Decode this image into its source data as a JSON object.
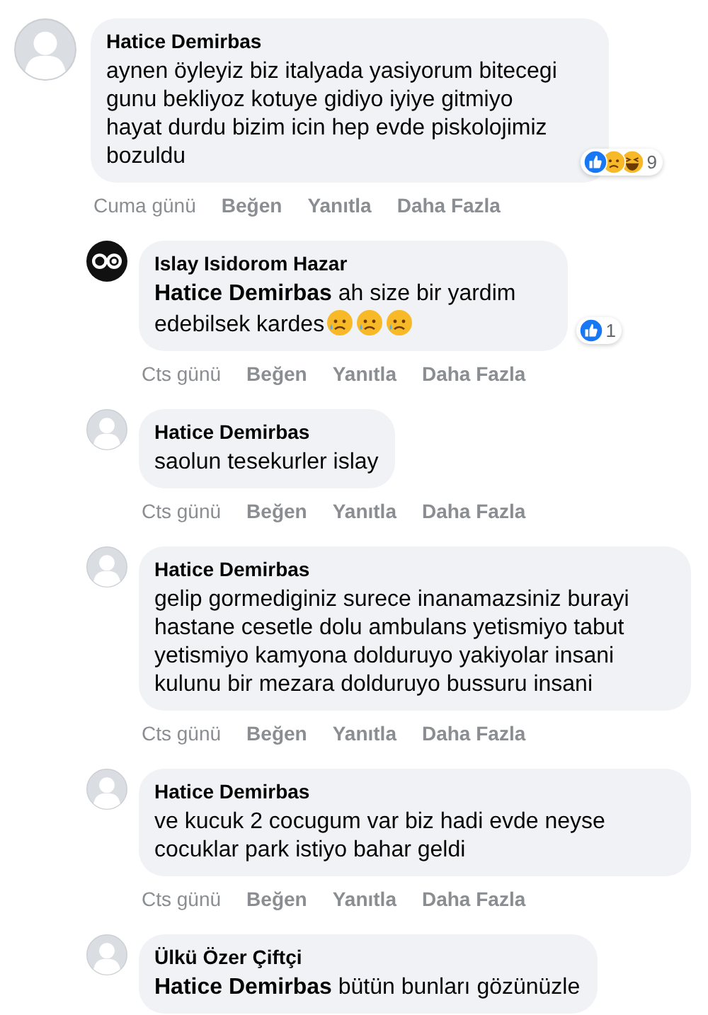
{
  "comments": [
    {
      "kind": "top",
      "avatar": {
        "kind": "default"
      },
      "author": "Hatice Demirbas",
      "text": "aynen öyleyiz biz italyada yasiyorum bitecegi gunu bekliyoz kotuye gidiyo iyiye gitmiyo hayat durdu bizim icin hep evde piskolojimiz bozuldu",
      "reactions": [
        {
          "kind": "like"
        },
        {
          "kind": "sad"
        },
        {
          "kind": "haha"
        }
      ],
      "reaction_count": "9",
      "time": "Cuma günü",
      "actions": [
        "Beğen",
        "Yanıtla",
        "Daha Fazla"
      ]
    },
    {
      "kind": "reply",
      "avatar": {
        "kind": "custom"
      },
      "author": "Islay Isidorom Hazar",
      "text": "**Hatice Demirbas** ah size bir yardim edebilsek kardes",
      "emojis": [
        {
          "kind": "sad"
        },
        {
          "kind": "sad"
        },
        {
          "kind": "sad"
        }
      ],
      "reactions": [
        {
          "kind": "like"
        }
      ],
      "reaction_count": "1",
      "time": "Cts günü",
      "actions": [
        "Beğen",
        "Yanıtla",
        "Daha Fazla"
      ]
    },
    {
      "kind": "reply",
      "avatar": {
        "kind": "default"
      },
      "author": "Hatice Demirbas",
      "text": "saolun tesekurler islay",
      "time": "Cts günü",
      "actions": [
        "Beğen",
        "Yanıtla",
        "Daha Fazla"
      ]
    },
    {
      "kind": "reply",
      "avatar": {
        "kind": "default"
      },
      "author": "Hatice Demirbas",
      "text": "gelip gormediginiz surece inanamazsiniz burayi hastane cesetle dolu ambulans yetismiyo tabut yetismiyo kamyona dolduruyo yakiyolar insani kulunu bir mezara dolduruyo bussuru insani",
      "time": "Cts günü",
      "actions": [
        "Beğen",
        "Yanıtla",
        "Daha Fazla"
      ]
    },
    {
      "kind": "reply",
      "avatar": {
        "kind": "default"
      },
      "author": "Hatice Demirbas",
      "text": "ve kucuk 2 cocugum var biz hadi evde neyse cocuklar park istiyo bahar geldi",
      "time": "Cts günü",
      "actions": [
        "Beğen",
        "Yanıtla",
        "Daha Fazla"
      ]
    },
    {
      "kind": "reply",
      "avatar": {
        "kind": "default"
      },
      "author": "Ülkü Özer Çiftçi",
      "text": "**Hatice Demirbas** bütün bunları gözünüzle"
    }
  ]
}
